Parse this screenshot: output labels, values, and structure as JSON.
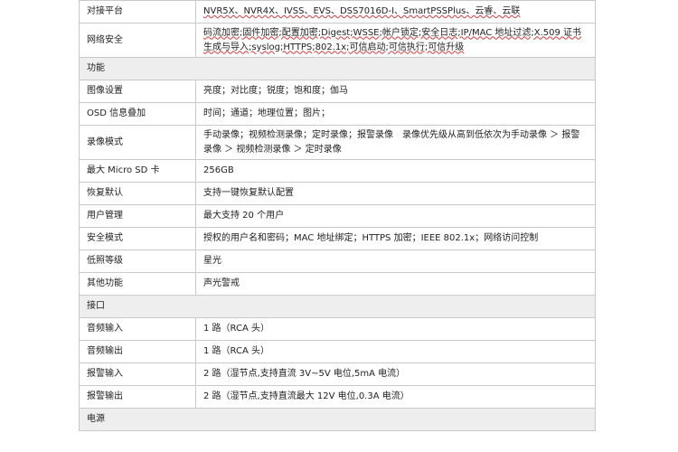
{
  "rows": [
    {
      "key": "对接平台",
      "value": "NVR5X、NVR4X、IVSS、EVS、DSS7016D-I、SmartPSSPlus、云睿、云联"
    },
    {
      "key": "网络安全",
      "value": "码流加密;固件加密;配置加密;Digest;WSSE;帐户锁定;安全日志;IP/MAC 地址过滤;X.509 证书生成与导入;syslog;HTTPS;802.1x;可信启动;可信执行;可信升级"
    },
    {
      "section": "功能"
    },
    {
      "key": "图像设置",
      "value": "亮度；对比度；锐度；饱和度；伽马"
    },
    {
      "key": "OSD 信息叠加",
      "value": "时间；通道；地理位置；图片；"
    },
    {
      "key": "录像模式",
      "value": "手动录像；视频检测录像；定时录像；报警录像　录像优先级从高到低依次为手动录像 ＞ 报警录像 ＞ 视频检测录像 ＞ 定时录像"
    },
    {
      "key": "最大 Micro SD 卡",
      "value": "256GB"
    },
    {
      "key": "恢复默认",
      "value": "支持一键恢复默认配置"
    },
    {
      "key": "用户管理",
      "value": "最大支持 20 个用户"
    },
    {
      "key": "安全模式",
      "value": "授权的用户名和密码；MAC 地址绑定；HTTPS 加密；IEEE 802.1x；网络访问控制"
    },
    {
      "key": "低照等级",
      "value": "星光"
    },
    {
      "key": "其他功能",
      "value": "声光警戒"
    },
    {
      "section": "接口"
    },
    {
      "key": "音频输入",
      "value": "1 路（RCA 头）"
    },
    {
      "key": "音频输出",
      "value": "1 路（RCA 头）"
    },
    {
      "key": "报警输入",
      "value": "2 路（湿节点,支持直流 3V~5V 电位,5mA 电流）"
    },
    {
      "key": "报警输出",
      "value": "2 路（湿节点,支持直流最大 12V 电位,0.3A 电流）"
    },
    {
      "section": "电源"
    }
  ]
}
